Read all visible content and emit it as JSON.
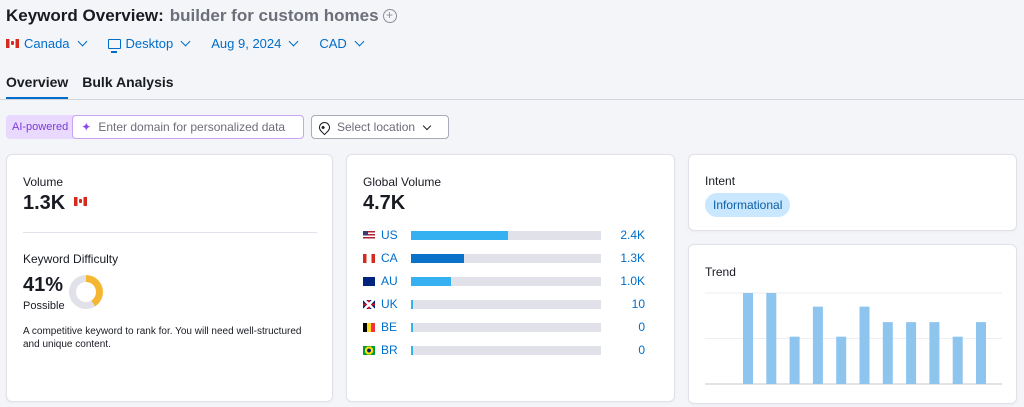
{
  "header": {
    "title_prefix": "Keyword Overview:",
    "keyword": "builder for custom homes"
  },
  "filters": {
    "country": "Canada",
    "device": "Desktop",
    "date": "Aug 9, 2024",
    "currency": "CAD"
  },
  "tabs": [
    {
      "label": "Overview",
      "active": true
    },
    {
      "label": "Bulk Analysis",
      "active": false
    }
  ],
  "ai_bar": {
    "badge": "AI-powered",
    "placeholder": "Enter domain for personalized data",
    "location_placeholder": "Select location"
  },
  "volume_card": {
    "label": "Volume",
    "value": "1.3K",
    "kd_label": "Keyword Difficulty",
    "kd_value": "41%",
    "kd_level": "Possible",
    "kd_percent": 41,
    "kd_color": "#f5b731",
    "description": "A competitive keyword to rank for. You will need well-structured and unique content."
  },
  "global_card": {
    "label": "Global Volume",
    "value": "4.7K",
    "rows": [
      {
        "code": "US",
        "value": "2.4K",
        "share": 0.51,
        "color": "#35b0f0"
      },
      {
        "code": "CA",
        "value": "1.3K",
        "share": 0.28,
        "color": "#0a73c9"
      },
      {
        "code": "AU",
        "value": "1.0K",
        "share": 0.21,
        "color": "#35b0f0"
      },
      {
        "code": "UK",
        "value": "10",
        "share": 0.01,
        "color": "#35b0f0"
      },
      {
        "code": "BE",
        "value": "0",
        "share": 0.01,
        "color": "#35b0f0"
      },
      {
        "code": "BR",
        "value": "0",
        "share": 0.01,
        "color": "#35b0f0"
      }
    ]
  },
  "intent_card": {
    "label": "Intent",
    "badge": "Informational"
  },
  "trend_card": {
    "label": "Trend",
    "bar_color": "#8ec5ef"
  },
  "chart_data": {
    "type": "bar",
    "title": "Trend",
    "values": [
      1.0,
      1.0,
      0.52,
      0.85,
      0.52,
      0.85,
      0.68,
      0.68,
      0.68,
      0.52,
      0.68
    ],
    "ylim": [
      0,
      1
    ],
    "grid": true
  }
}
